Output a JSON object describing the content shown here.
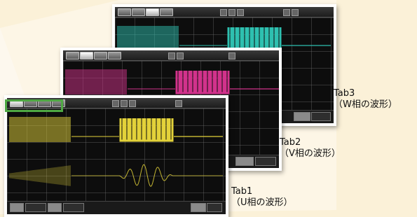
{
  "tabs": [
    {
      "id": "tab1",
      "title": "Tab1",
      "subtitle": "（U相の波形）",
      "trace_color": "#e3d23a"
    },
    {
      "id": "tab2",
      "title": "Tab2",
      "subtitle": "（V相の波形）",
      "trace_color": "#d2328c"
    },
    {
      "id": "tab3",
      "title": "Tab3",
      "subtitle": "（W相の波形）",
      "trace_color": "#2ec0b0"
    }
  ],
  "colors": {
    "background": "#fbf1d8",
    "highlight_frame": "#4fa843",
    "grid": "#787878"
  },
  "icons": {
    "tab_button": "tab-button-icon",
    "toolbar_control": "toolbar-control-icon"
  }
}
